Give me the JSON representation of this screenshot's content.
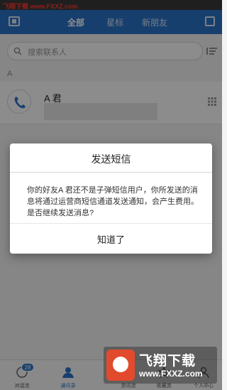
{
  "watermark": {
    "top_text": "飞翔下载 www.FXXZ.com",
    "logo_title": "飞翔下载",
    "logo_url": "www.FXXZ.com"
  },
  "header": {
    "tabs": [
      {
        "label": "全部",
        "active": true
      },
      {
        "label": "星标",
        "active": false
      },
      {
        "label": "新朋友",
        "active": false
      }
    ],
    "left_icon": "contacts-card-icon",
    "right_icon": "add-contact-icon"
  },
  "search": {
    "placeholder": "搜索联系人",
    "sort_icon": "sort-list-icon"
  },
  "contacts": {
    "section_letter": "A",
    "items": [
      {
        "name": "A 君",
        "avatar_icon": "phone-icon",
        "right_icon": "dialpad-icon"
      }
    ]
  },
  "dialog": {
    "title": "发送短信",
    "message": "你的好友A 君还不是子弹短信用户，你所发送的消息将通过运营商短信通道发送通知，会产生费用。是否继续发送消息?",
    "button": "知道了"
  },
  "bottom_nav": {
    "items": [
      {
        "label": "对话流",
        "icon": "chat-icon",
        "badge": "28"
      },
      {
        "label": "通讯录",
        "icon": "contacts-icon",
        "active": true
      },
      {
        "label": "",
        "icon": "hidden-icon"
      },
      {
        "label": "资讯流",
        "icon": "news-icon"
      },
      {
        "label": "收藏流",
        "icon": "favorites-icon"
      },
      {
        "label": "个人中心",
        "icon": "profile-icon"
      }
    ]
  },
  "colors": {
    "accent": "#2b74c9",
    "overlay": "rgba(0,0,0,0.45)"
  }
}
